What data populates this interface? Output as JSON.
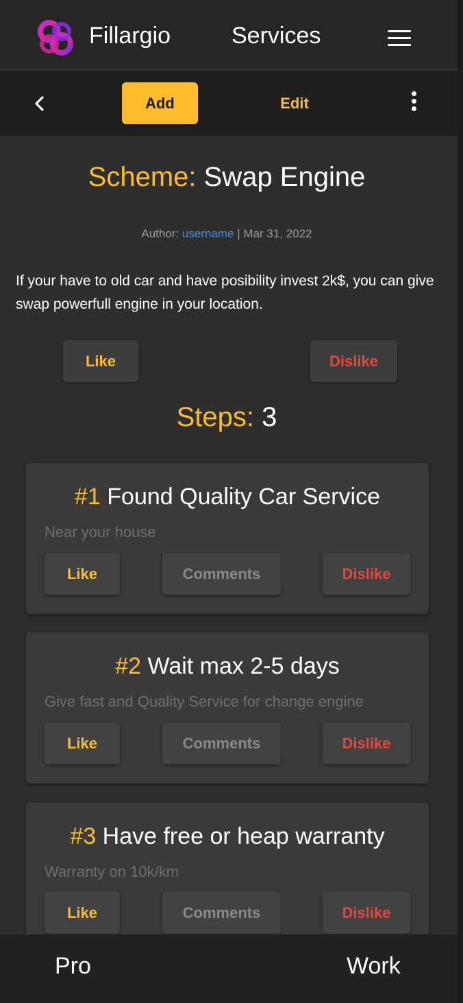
{
  "header": {
    "brand": "Fillargio",
    "title": "Services"
  },
  "toolbar": {
    "add_label": "Add",
    "edit_label": "Edit"
  },
  "scheme": {
    "prefix": "Scheme:",
    "name": "Swap Engine",
    "author_label": "Author:",
    "author": "username",
    "separator": "|",
    "date": "Mar 31, 2022",
    "description": "If your have to old car and have posibility invest 2k$, you can give swap powerfull engine in your location.",
    "like_label": "Like",
    "dislike_label": "Dislike"
  },
  "steps": {
    "prefix": "Steps:",
    "count": "3",
    "items": [
      {
        "number": "#1",
        "title": "Found Quality Car Service",
        "subtitle": "Near your house",
        "like": "Like",
        "comments": "Comments",
        "dislike": "Dislike"
      },
      {
        "number": "#2",
        "title": "Wait max 2-5 days",
        "subtitle": "Give fast and Quality Service for change engine",
        "like": "Like",
        "comments": "Comments",
        "dislike": "Dislike"
      },
      {
        "number": "#3",
        "title": "Have free or heap warranty",
        "subtitle": "Warranty on 10k/km",
        "like": "Like",
        "comments": "Comments",
        "dislike": "Dislike"
      }
    ]
  },
  "footer": {
    "left": "Pro",
    "right": "Work"
  },
  "colors": {
    "accent": "#fcbc2b",
    "danger": "#e8453c",
    "link": "#3b8fe0",
    "background": "#2e2e2e"
  }
}
